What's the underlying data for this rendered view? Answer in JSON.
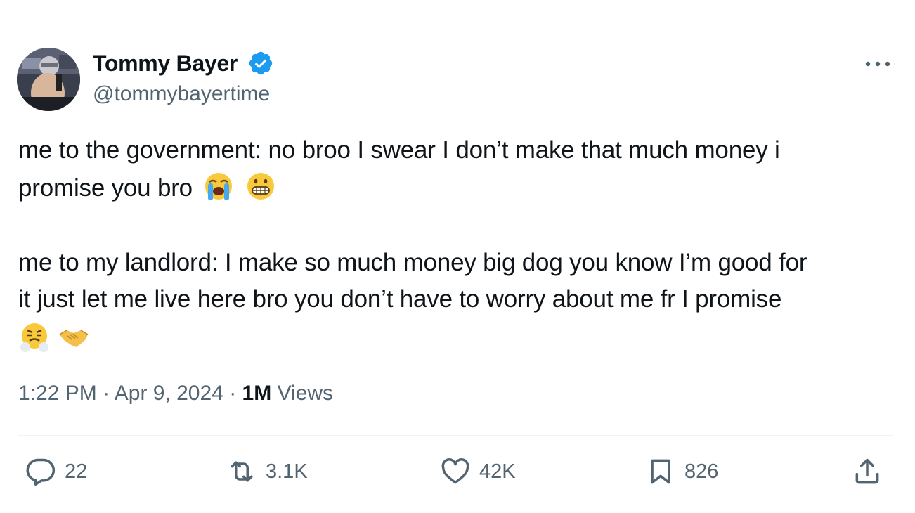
{
  "author": {
    "display_name": "Tommy Bayer",
    "handle": "@tommybayertime",
    "verified_color": "#1d9bf0"
  },
  "tweet": {
    "line1": "me to the government: no broo I swear I don’t make that much money i",
    "line2": "promise you bro",
    "line2_emojis": [
      "loudly-crying-face",
      "grimacing-face"
    ],
    "line3": "me to my landlord:  I make so much money big dog you know I’m good for",
    "line4": "it just let me live here bro you don’t have to worry about me fr I promise",
    "line5_emojis": [
      "face-with-steam-from-nose",
      "handshake"
    ]
  },
  "meta": {
    "time": "1:22 PM",
    "sep1": " · ",
    "date": "Apr 9, 2024",
    "sep2": " · ",
    "views_count": "1M",
    "views_label": " Views"
  },
  "actions": {
    "reply_count": "22",
    "repost_count": "3.1K",
    "like_count": "42K",
    "bookmark_count": "826"
  },
  "icons": [
    "more-icon",
    "verified-icon",
    "reply-icon",
    "repost-icon",
    "like-icon",
    "bookmark-icon",
    "share-icon"
  ],
  "colors": {
    "text": "#0f1419",
    "secondary": "#536471",
    "accent": "#1d9bf0",
    "divider": "#eff3f4"
  }
}
